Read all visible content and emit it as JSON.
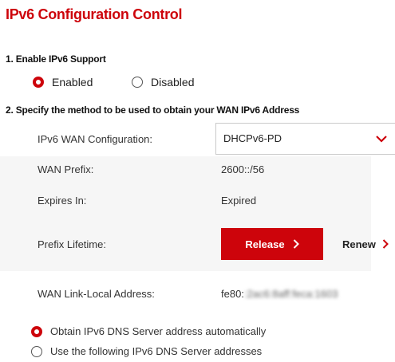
{
  "page_title": "IPv6 Configuration Control",
  "section1": {
    "heading": "1. Enable IPv6 Support",
    "options": [
      {
        "label": "Enabled",
        "selected": true
      },
      {
        "label": "Disabled",
        "selected": false
      }
    ]
  },
  "section2": {
    "heading": "2. Specify the method to be used to obtain your WAN IPv6 Address",
    "wan_config_label": "IPv6 WAN Configuration:",
    "wan_config_value": "DHCPv6-PD",
    "wan_prefix_label": "WAN Prefix:",
    "wan_prefix_value": "2600::/56",
    "expires_label": "Expires In:",
    "expires_value": "Expired",
    "prefix_lifetime_label": "Prefix Lifetime:",
    "release_label": "Release",
    "renew_label": "Renew",
    "link_local_label": "WAN Link-Local Address:",
    "link_local_prefix": "fe80:",
    "link_local_redacted": ":2ac6:8aff:feca:1603"
  },
  "dns": {
    "options": [
      {
        "label": "Obtain IPv6 DNS Server address automatically",
        "selected": true
      },
      {
        "label": "Use the following IPv6 DNS Server addresses",
        "selected": false
      }
    ]
  },
  "colors": {
    "brand_red": "#cd040b",
    "panel_gray": "#f6f6f6"
  }
}
